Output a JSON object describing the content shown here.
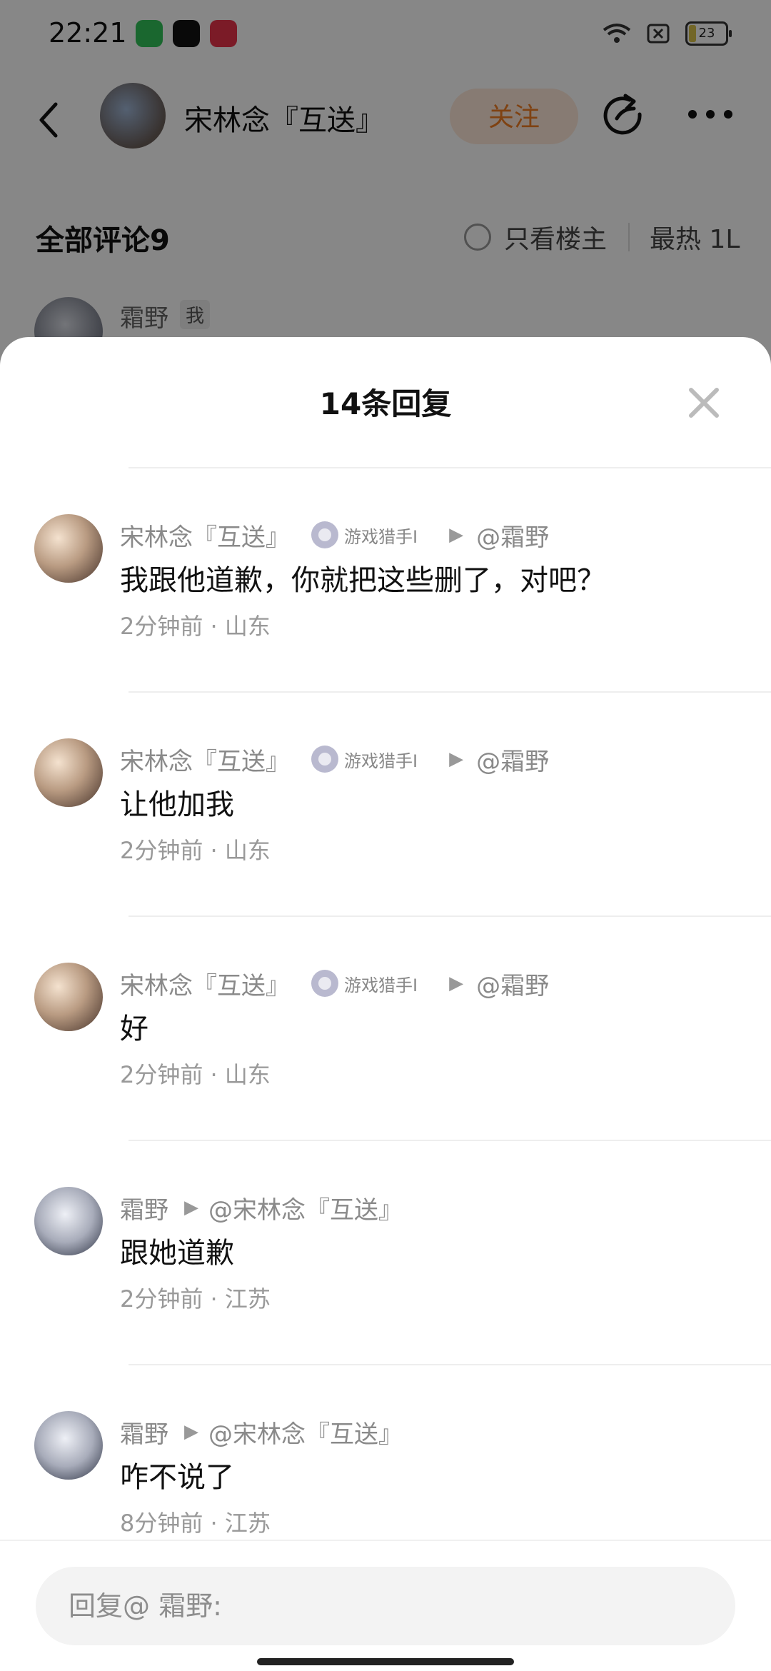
{
  "status_bar": {
    "time": "22:21",
    "battery": "23"
  },
  "post_header": {
    "author": "宋林念『互送』",
    "follow_label": "关注"
  },
  "comments_bar": {
    "title": "全部评论9",
    "only_op": "只看楼主",
    "sort": "最热 1L"
  },
  "peek": {
    "name": "霜野",
    "badge": "我"
  },
  "sheet": {
    "title": "14条回复",
    "replies": [
      {
        "name": "宋林念『互送』",
        "medal": "游戏猎手I",
        "target": "@霜野",
        "text": "我跟他道歉，你就把这些删了，对吧？",
        "meta": "2分钟前 · 山东"
      },
      {
        "name": "宋林念『互送』",
        "medal": "游戏猎手I",
        "target": "@霜野",
        "text": "让他加我",
        "meta": "2分钟前 · 山东"
      },
      {
        "name": "宋林念『互送』",
        "medal": "游戏猎手I",
        "target": "@霜野",
        "text": "好",
        "meta": "2分钟前 · 山东"
      },
      {
        "name": "霜野",
        "target": "@宋林念『互送』",
        "text": "跟她道歉",
        "meta": "2分钟前 · 江苏"
      },
      {
        "name": "霜野",
        "target": "@宋林念『互送』",
        "text": "咋不说了",
        "meta": "8分钟前 · 江苏"
      }
    ]
  },
  "input": {
    "placeholder": "回复@ 霜野:"
  }
}
